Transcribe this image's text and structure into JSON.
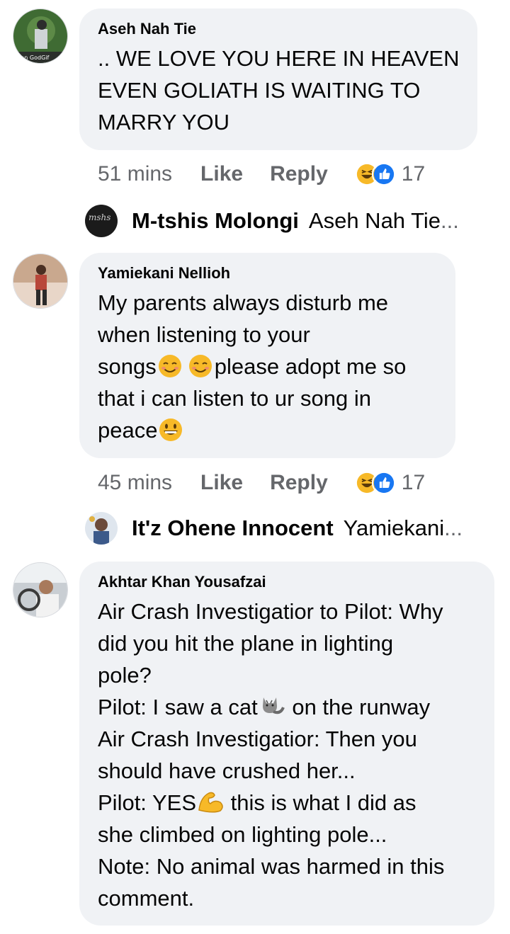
{
  "comments": [
    {
      "author": "Aseh Nah Tie",
      "avatar_text": "can GodGif",
      "lines": [
        ".. WE LOVE YOU HERE IN HEAVEN",
        "EVEN GOLIATH IS WAITING TO",
        "MARRY YOU"
      ],
      "time": "51 mins",
      "like": "Like",
      "reply": "Reply",
      "reaction_count": "17",
      "reply_preview": {
        "author": "M-tshis Molongi",
        "snippet": "Aseh Nah Tie",
        "ellipsis": "..."
      }
    },
    {
      "author": "Yamiekani Nellioh",
      "lines": [
        "My parents always disturb me",
        "when listening to your",
        "songs",
        "please adopt me so",
        "that i can listen to ur song in",
        "peace"
      ],
      "time": "45 mins",
      "like": "Like",
      "reply": "Reply",
      "reaction_count": "17",
      "reply_preview": {
        "author": "It'z Ohene Innocent",
        "snippet": "Yamiekani",
        "ellipsis": "..."
      }
    },
    {
      "author": "Akhtar Khan Yousafzai",
      "lines": [
        "Air Crash Investigatior to Pilot: Why",
        "did you hit the plane in lighting",
        "pole?",
        "Pilot: I saw a cat",
        " on the runway",
        "Air Crash Investigatior: Then you",
        "should have crushed her...",
        "Pilot: YES",
        " this is what I did as",
        "she climbed on lighting pole...",
        "Note: No animal was harmed in this",
        "comment."
      ]
    }
  ],
  "colors": {
    "bubble": "#f0f2f5",
    "muted": "#65676b",
    "like_blue": "#1877f2",
    "haha_yellow": "#f7b928"
  },
  "icons": {
    "haha": "haha-reaction-icon",
    "like": "like-reaction-icon"
  }
}
